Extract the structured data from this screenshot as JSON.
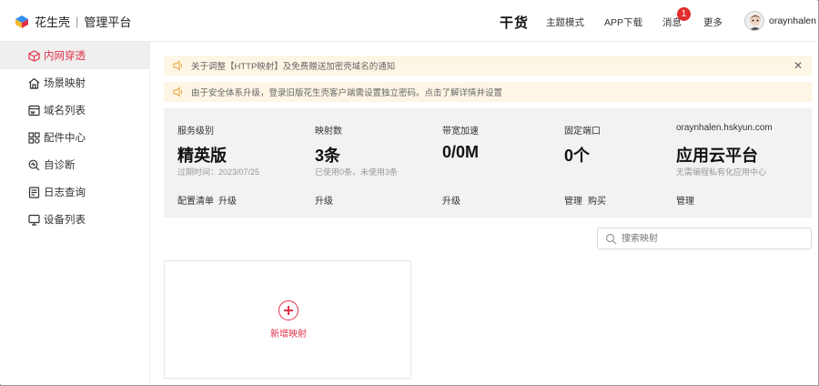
{
  "header": {
    "brand": "花生壳",
    "separator": "|",
    "product": "管理平台",
    "ganhuo": "干货",
    "nav": [
      "主题模式",
      "APP下载",
      "消息",
      "更多"
    ],
    "message_badge": "1",
    "username": "oraynhalen"
  },
  "sidebar": {
    "items": [
      {
        "label": "内网穿透",
        "icon": "cube-icon",
        "active": true
      },
      {
        "label": "场景映射",
        "icon": "house-icon",
        "active": false
      },
      {
        "label": "域名列表",
        "icon": "www-icon",
        "active": false
      },
      {
        "label": "配件中心",
        "icon": "grid-icon",
        "active": false
      },
      {
        "label": "自诊断",
        "icon": "diagnose-icon",
        "active": false
      },
      {
        "label": "日志查询",
        "icon": "log-icon",
        "active": false
      },
      {
        "label": "设备列表",
        "icon": "monitor-icon",
        "active": false
      }
    ]
  },
  "notices": [
    {
      "text": "关于调整【HTTP映射】及免费赠送加密壳域名的通知",
      "closable": true
    },
    {
      "text": "由于安全体系升级，登录旧版花生壳客户端需设置独立密码。点击了解详情并设置",
      "closable": false
    }
  ],
  "stats": {
    "service": {
      "label": "服务级别",
      "value": "精英版",
      "sub": "过期时间：2023/07/25",
      "actions": [
        "配置清单",
        "升级"
      ]
    },
    "mappings": {
      "label": "映射数",
      "value": "3条",
      "sub": "已使用0条、未使用3条",
      "actions": [
        "升级"
      ]
    },
    "bandwidth": {
      "label": "带宽加速",
      "value": "0/0M",
      "sub": "",
      "actions": [
        "升级"
      ]
    },
    "port": {
      "label": "固定端口",
      "value": "0个",
      "sub": "",
      "actions": [
        "管理",
        "购买"
      ]
    },
    "cloud": {
      "label": "oraynhalen.hskyun.com",
      "value": "应用云平台",
      "sub": "无需编程私有化应用中心",
      "actions": [
        "管理"
      ]
    }
  },
  "search": {
    "placeholder": "搜索映射"
  },
  "add_card": {
    "label": "新增映射"
  },
  "colors": {
    "accent": "#e0314a",
    "notice_bg": "#fdf6e4",
    "stats_bg": "#f2f2f2",
    "badge": "#e02d2d"
  }
}
